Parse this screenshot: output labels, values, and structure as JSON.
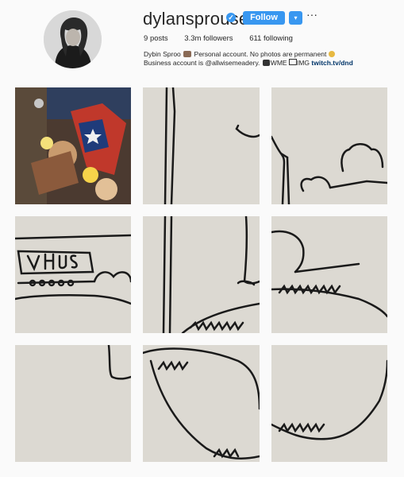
{
  "profile": {
    "username": "dylansprouse",
    "follow_label": "Follow",
    "dropdown_icon": "▾",
    "more_icon": "···",
    "verified_icon": "✓",
    "stats": {
      "posts_count": "9",
      "posts_label": "posts",
      "followers_count": "3.3m",
      "followers_label": "followers",
      "following_count": "611",
      "following_label": "following"
    },
    "bio": {
      "name": "Dybin Sproo",
      "line1": "Personal account. No photos are permanent",
      "line2_prefix": "Business account is @allwisemeadery.",
      "line2_wme": "WME",
      "line2_img": "IMG",
      "link": "twitch.tv/dnd"
    }
  },
  "colors": {
    "accent": "#3897f0",
    "tile_bg": "#dcd9d2",
    "ink": "#1a1a1a"
  },
  "icons": {
    "avatar": "profile-photo",
    "verified": "verified-badge-icon",
    "emoji_1": "man-emoji-icon",
    "emoji_2": "emoji-icons",
    "camera": "camera-icon",
    "mail": "mail-icon"
  },
  "grid": {
    "posts": [
      {
        "type": "comic-art"
      },
      {
        "type": "drawing"
      },
      {
        "type": "drawing"
      },
      {
        "type": "drawing"
      },
      {
        "type": "drawing"
      },
      {
        "type": "drawing"
      },
      {
        "type": "drawing"
      },
      {
        "type": "drawing"
      },
      {
        "type": "drawing"
      }
    ]
  }
}
